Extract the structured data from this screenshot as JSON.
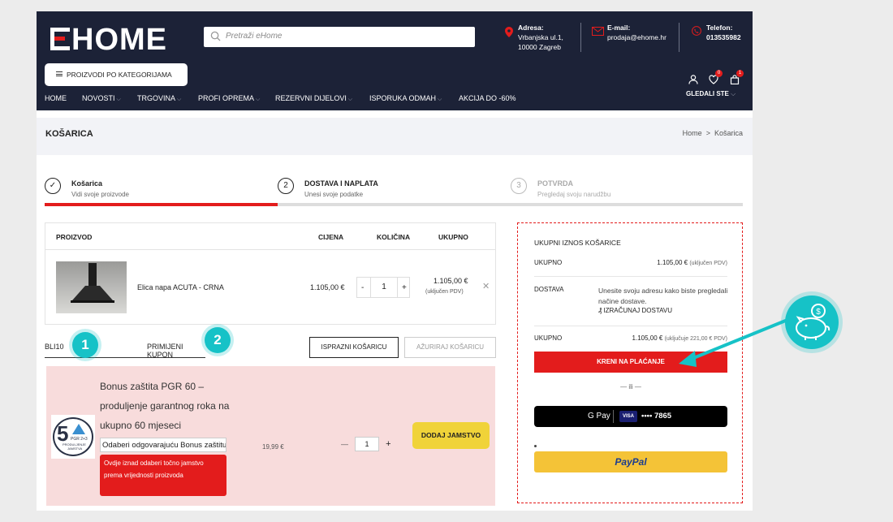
{
  "header": {
    "logo": "EHOME",
    "search_placeholder": "Pretraži eHome",
    "address_label": "Adresa:",
    "address_line1": "Vrbanjska ul.1,",
    "address_line2": "10000 Zagreb",
    "email_label": "E-mail:",
    "email": "prodaja@ehome.hr",
    "phone_label": "Telefon:",
    "phone": "013535982",
    "category_button": "PROIZVODI PO KATEGORIJAMA",
    "wishlist_count": "0",
    "cart_count": "1",
    "viewed_label": "GLEDALI STE",
    "nav": [
      "HOME",
      "NOVOSTI",
      "TRGOVINA",
      "PROFI OPREMA",
      "REZERVNI DIJELOVI",
      "ISPORUKA ODMAH",
      "AKCIJA DO -60%"
    ]
  },
  "page": {
    "title": "KOŠARICA",
    "breadcrumb_home": "Home",
    "breadcrumb_sep": ">",
    "breadcrumb_current": "Košarica"
  },
  "steps": [
    {
      "num": "✓",
      "name": "Košarica",
      "sub": "Vidi svoje proizvode"
    },
    {
      "num": "2",
      "name": "DOSTAVA I NAPLATA",
      "sub": "Unesi svoje podatke"
    },
    {
      "num": "3",
      "name": "POTVRDA",
      "sub": "Pregledaj svoju narudžbu"
    }
  ],
  "cart": {
    "headers": {
      "product": "PROIZVOD",
      "price": "CIJENA",
      "qty": "KOLIČINA",
      "total": "UKUPNO"
    },
    "item": {
      "name": "Elica napa ACUTA - CRNA",
      "price": "1.105,00 €",
      "qty": "1",
      "total": "1.105,00 €",
      "vat": "(uključen PDV)"
    }
  },
  "coupon": {
    "code": "BLI10",
    "apply": "PRIMIJENI KUPON",
    "empty_cart": "ISPRAZNI KOŠARICU",
    "update_cart": "AŽURIRAJ KOŠARICU"
  },
  "callouts": {
    "one": "1",
    "two": "2"
  },
  "bonus": {
    "title": "Bonus zaštita PGR 60 – produljenje garantnog roka na ukupno 60 mjeseci",
    "select": "Odaberi odgovarajuću Bonus zaštitu",
    "warning": "Ovdje iznad odaberi točno jamstvo prema vrijednosti proizvoda",
    "price": "19,99 €",
    "qty": "1",
    "minus": "—",
    "plus": "+",
    "add_button": "DODAJ JAMSTVO",
    "logo_num": "5",
    "logo_text": "PGR 2+3",
    "logo_sub1": "PRODULJENJE",
    "logo_sub2": "JAMSTVA"
  },
  "summary": {
    "heading": "UKUPNI IZNOS KOŠARICE",
    "subtotal_label": "UKUPNO",
    "subtotal_value": "1.105,00 €",
    "subtotal_note": "(uključen PDV)",
    "shipping_label": "DOSTAVA",
    "shipping_text": "Unesite svoju adresu kako biste pregledali načine dostave.",
    "shipping_link": "IZRAČUNAJ DOSTAVU",
    "total_label": "UKUPNO",
    "total_value": "1.105,00 €",
    "total_note": "(uključuje 221,00 € PDV)",
    "checkout": "KRENI NA PLAĆANJE",
    "or": "— ili —",
    "gpay_label": "G Pay",
    "card_brand": "VISA",
    "card_digits": "•••• 7865",
    "paypal": "PayPal"
  },
  "colors": {
    "navy": "#1c2237",
    "red": "#e31c1c",
    "teal": "#16c2c7",
    "yellow": "#f0d339"
  }
}
